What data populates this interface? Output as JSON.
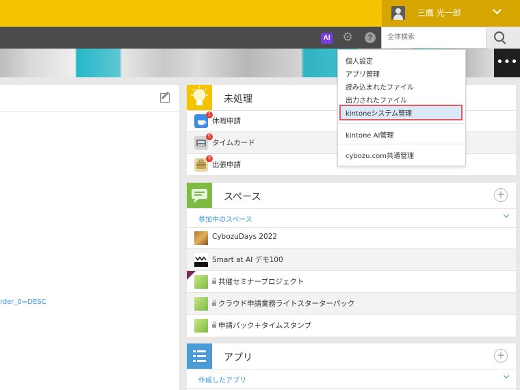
{
  "header": {
    "user_name": "三鷹 光一郎",
    "ai_label": "AI",
    "search_placeholder": "全体検索"
  },
  "banner": {
    "more_label": "•••"
  },
  "left_panel": {
    "link_text": "rder_0=DESC"
  },
  "unprocessed": {
    "title": "未処理",
    "items": [
      {
        "label": "休暇申請",
        "badge": "1"
      },
      {
        "label": "タイムカード",
        "badge": "5"
      },
      {
        "label": "出張申請",
        "badge": "3"
      }
    ]
  },
  "spaces": {
    "title": "スペース",
    "add_label": "+",
    "subheader": "参加中のスペース",
    "items": [
      {
        "label": "CybozuDays 2022",
        "locked": false
      },
      {
        "label": "Smart at AI デモ100",
        "locked": false
      },
      {
        "label": "共催セミナープロジェクト",
        "locked": true
      },
      {
        "label": "クラウド申請業務ライトスターターパック",
        "locked": true
      },
      {
        "label": "申請パック＋タイムスタンプ",
        "locked": true
      }
    ]
  },
  "apps": {
    "title": "アプリ",
    "add_label": "+",
    "subheader": "作成したアプリ"
  },
  "settings_menu": {
    "items": [
      {
        "label": "個人設定"
      },
      {
        "label": "アプリ管理"
      },
      {
        "label": "読み込まれたファイル"
      },
      {
        "label": "出力されたファイル"
      },
      {
        "label": "kintoneシステム管理",
        "highlighted": true
      },
      {
        "label": "kintone AI管理"
      },
      {
        "label": "cybozu.com共通管理"
      }
    ]
  },
  "colors": {
    "header_yellow": "#f4c400",
    "user_block": "#d7a500",
    "toolbar_gray": "#4b4b4b",
    "ai_purple": "#7a3ee0",
    "highlight_border": "#e9555f",
    "link_blue": "#3498db"
  }
}
